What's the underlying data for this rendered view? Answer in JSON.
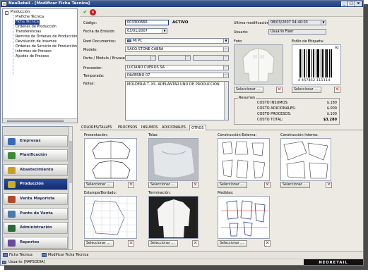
{
  "window": {
    "title": "NeoRetail - [Modificar Ficha Técnica]"
  },
  "titlebar_buttons": [
    "_",
    "□",
    "x"
  ],
  "tree": {
    "root": "Producción",
    "items": [
      "Prefiche Técnica",
      "Ficha Técnica",
      "Órdenes de Producción",
      "Transferencias",
      "Remitos de Órdenes de Producción",
      "Devolución de Insumos",
      "Órdenes de Servicio de Producción",
      "Informes de Proceso",
      "Ajustes de Proceso"
    ],
    "selected_index": 1
  },
  "nav": {
    "items": [
      {
        "label": "Empresas",
        "icon": "building-icon",
        "color": "#3a6bb8"
      },
      {
        "label": "Planificación",
        "icon": "planning-icon",
        "color": "#3a8a3a"
      },
      {
        "label": "Abastecimiento",
        "icon": "supply-icon",
        "color": "#c8a020"
      },
      {
        "label": "Producción",
        "icon": "production-icon",
        "color": "#c8b020"
      },
      {
        "label": "Venta Mayorista",
        "icon": "wholesale-icon",
        "color": "#b04a2a"
      },
      {
        "label": "Punto de Venta",
        "icon": "pos-icon",
        "color": "#4a7ab0"
      },
      {
        "label": "Administración",
        "icon": "admin-icon",
        "color": "#2a6a3a"
      },
      {
        "label": "Reportes",
        "icon": "reports-icon",
        "color": "#6a4aa0"
      }
    ],
    "active_index": 3
  },
  "toolbar": {
    "ok_icon": "check-icon",
    "cancel_icon": "cancel-icon"
  },
  "form": {
    "codigo_label": "Código:",
    "codigo_value": "003300666",
    "status": "ACTIVO",
    "fecha_label": "Fecha de Emisión:",
    "fecha_value": "03/01/2007",
    "root_label": "Root Documentos:",
    "root_value": "Mi PC",
    "modelo_label": "Modelo:",
    "modelo_value": "SACO STONE CABRA",
    "parte_label": "Parte / Módulo / Envase:",
    "proveedor_label": "Proveedor:",
    "proveedor_value": "LUCIANO CUEROS SA",
    "temporada_label": "Temporada:",
    "temporada_value": "INVIERNO 07",
    "notas_label": "Notas:",
    "notas_value": "MOLDERIA T. XS. ADELANTAR UNO DE PRODUCCION.",
    "ultima_label": "Ultima modificación:",
    "ultima_value": "08/03/2007 04:40:03",
    "usuario_label": "Usuario:",
    "usuario_value": "Usuario Fixer",
    "foto_label": "Foto:",
    "etiqueta_label": "Estilo de Etiqueta:",
    "barcode_text": "4 457852 111114",
    "barcode_num": "92"
  },
  "buttons": {
    "seleccionar": "Seleccionar ..."
  },
  "resumen": {
    "title": "Resumen",
    "rows": [
      {
        "label": "COSTO INSUMOS:",
        "value": "$.180"
      },
      {
        "label": "COSTO ADICIONALES:",
        "value": "$.000"
      },
      {
        "label": "COSTO PROCESOS:",
        "value": "$.100"
      },
      {
        "label": "COSTO TOTAL:",
        "value": "$3.280"
      }
    ]
  },
  "tabs": [
    "COLORES/TALLES",
    "PROCESOS",
    "INSUMOS",
    "ADICIONALES",
    "OTROS"
  ],
  "active_tab": 4,
  "panels": [
    {
      "label": "Presentación:"
    },
    {
      "label": "Telas:"
    },
    {
      "label": "Construcción Externa:"
    },
    {
      "label": "Construcción Interna:"
    },
    {
      "label": "Estampa/Bordado:"
    },
    {
      "label": "Terminación:"
    },
    {
      "label": "Medidas:"
    }
  ],
  "bottom_tabs": [
    "Ficha Técnica",
    "Modificar Ficha Técnica"
  ],
  "status": {
    "user_label": "Usuario:",
    "user_value": "[RAPSODIA]",
    "logo": "NEORETAIL"
  }
}
